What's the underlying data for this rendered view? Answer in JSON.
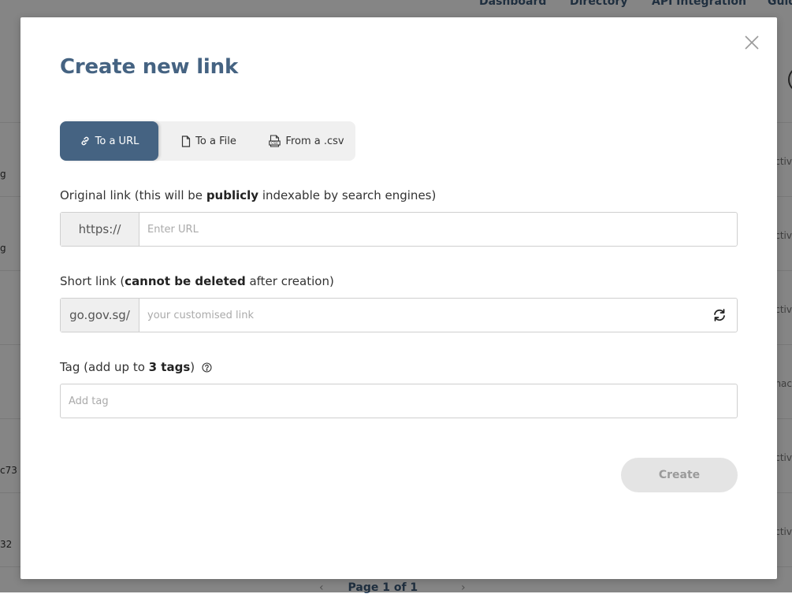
{
  "background": {
    "nav": [
      "Dashboard",
      "Directory",
      "API Integration",
      "Guid"
    ],
    "rows": [
      {
        "left": "g",
        "right": "ctiv"
      },
      {
        "left": "g",
        "right": "ctiv"
      },
      {
        "left": "",
        "right": "ctiv"
      },
      {
        "left": "",
        "right": "nac"
      },
      {
        "left": "c73",
        "right": "ctiv"
      },
      {
        "left": "32",
        "right": "ctiv"
      }
    ],
    "pager": {
      "prev": "‹",
      "label": "Page 1 of 1",
      "next": "›"
    }
  },
  "modal": {
    "title": "Create new link",
    "close_icon": "close-icon",
    "tabs": [
      {
        "label": "To a URL",
        "icon": "link-icon",
        "active": true
      },
      {
        "label": "To a File",
        "icon": "file-icon",
        "active": false
      },
      {
        "label": "From a .csv",
        "icon": "csv-icon",
        "active": false
      }
    ],
    "original_link": {
      "label_pre": "Original link (this will be ",
      "label_bold": "publicly",
      "label_post": " indexable by search engines)",
      "prefix": "https://",
      "placeholder": "Enter URL",
      "value": ""
    },
    "short_link": {
      "label_pre": "Short link (",
      "label_bold": "cannot be deleted",
      "label_post": " after creation)",
      "prefix": "go.gov.sg/",
      "placeholder": "your customised link",
      "value": "",
      "refresh_icon": "refresh-icon"
    },
    "tag": {
      "label_pre": "Tag (add up to ",
      "label_bold": "3 tags",
      "label_post": ")",
      "help_icon": "help-icon",
      "placeholder": "Add tag",
      "value": ""
    },
    "create_label": "Create"
  },
  "colors": {
    "accent": "#456382",
    "overlay": "rgba(0,0,0,0.48)",
    "button_disabled_bg": "#e4e4e4",
    "button_disabled_text": "#9a9a9a"
  }
}
